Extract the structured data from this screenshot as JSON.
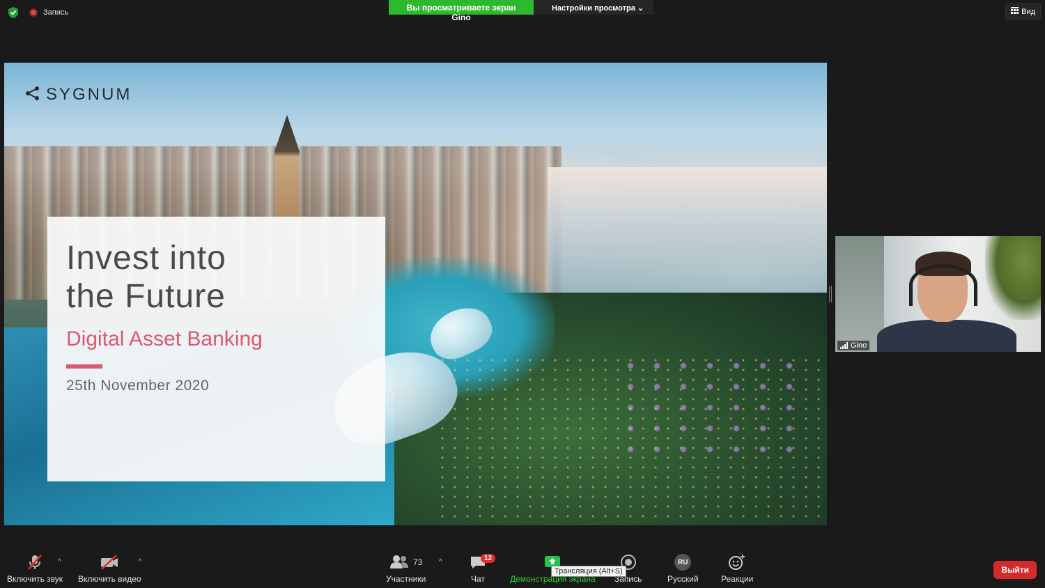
{
  "top": {
    "recording_label": "Запись",
    "banner_text": "Вы просматриваете экран Gino",
    "view_settings_label": "Настройки просмотра",
    "view_button_label": "Вид"
  },
  "slide": {
    "logo": "SYGNUM",
    "title_line1": "Invest into",
    "title_line2": "the Future",
    "subtitle": "Digital Asset Banking",
    "date": "25th November 2020"
  },
  "participant": {
    "name": "Gino"
  },
  "toolbar": {
    "mic_label": "Включить звук",
    "video_label": "Включить видео",
    "participants_label": "Участники",
    "participants_count": "73",
    "chat_label": "Чат",
    "chat_badge": "12",
    "share_label": "Демонстрация экрана",
    "share_tooltip": "Трансляция (Alt+S)",
    "record_label": "Запись",
    "language_label": "Русский",
    "language_code": "RU",
    "reactions_label": "Реакции",
    "leave_label": "Выйти"
  },
  "colors": {
    "accent_green": "#2eb82e",
    "leave_red": "#d42a2a",
    "brand_pink": "#e0566e"
  },
  "icons": [
    "shield-icon",
    "record-icon",
    "grid-icon",
    "muted-mic-icon",
    "video-off-icon",
    "participants-icon",
    "chat-icon",
    "share-screen-icon",
    "record-icon",
    "language-icon",
    "reactions-icon",
    "sygnum-logo-icon",
    "signal-icon"
  ]
}
